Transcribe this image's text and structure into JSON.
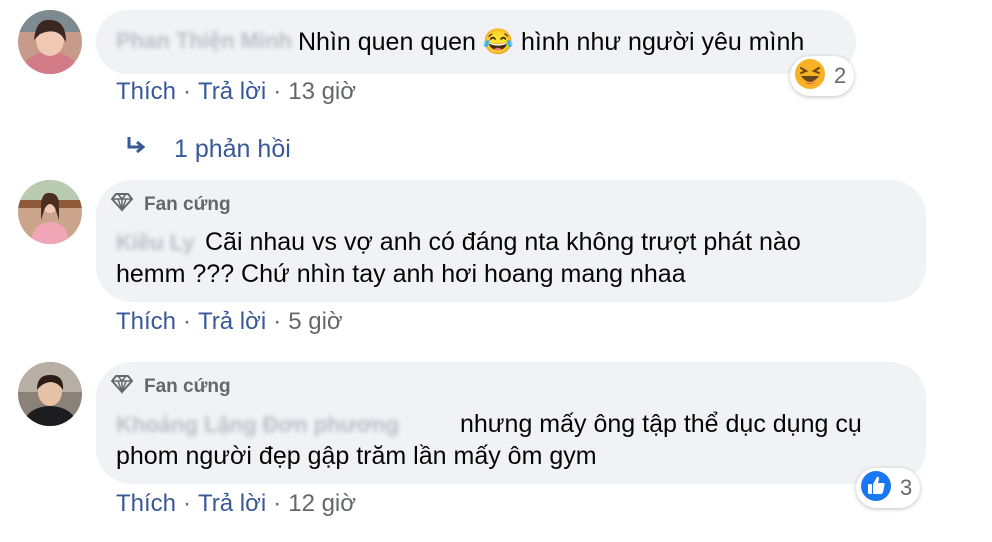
{
  "comments": [
    {
      "author_blurred": "Phan Thiện Minh",
      "text_lines": [
        "Nhìn quen quen 😂 hình như người yêu mình"
      ],
      "actions": {
        "like": "Thích",
        "reply": "Trả lời",
        "time": "13 giờ"
      },
      "reaction": {
        "icon": "laughing-emoji-icon",
        "count": "2"
      },
      "replies": {
        "label": "1 phản hồi"
      }
    },
    {
      "badge": "Fan cứng",
      "author_blurred": "Kiều Ly",
      "text_lines": [
        "Cãi nhau vs vợ anh có đáng nta không trượt phát nào",
        "hemm ??? Chứ nhìn tay anh hơi hoang mang nhaa"
      ],
      "actions": {
        "like": "Thích",
        "reply": "Trả lời",
        "time": "5 giờ"
      }
    },
    {
      "badge": "Fan cứng",
      "author_blurred": "Khoảng Lặng Đơn phương",
      "text_lines": [
        "nhưng mấy ông tập thể dục dụng cụ",
        "phom người đẹp gập trăm lần mấy ôm gym"
      ],
      "actions": {
        "like": "Thích",
        "reply": "Trả lời",
        "time": "12 giờ"
      },
      "reaction": {
        "icon": "thumbs-up-icon",
        "count": "3"
      }
    }
  ],
  "colors": {
    "bubble": "#f0f2f5",
    "link": "#385898",
    "muted": "#65676b",
    "like_blue": "#1877f2"
  }
}
